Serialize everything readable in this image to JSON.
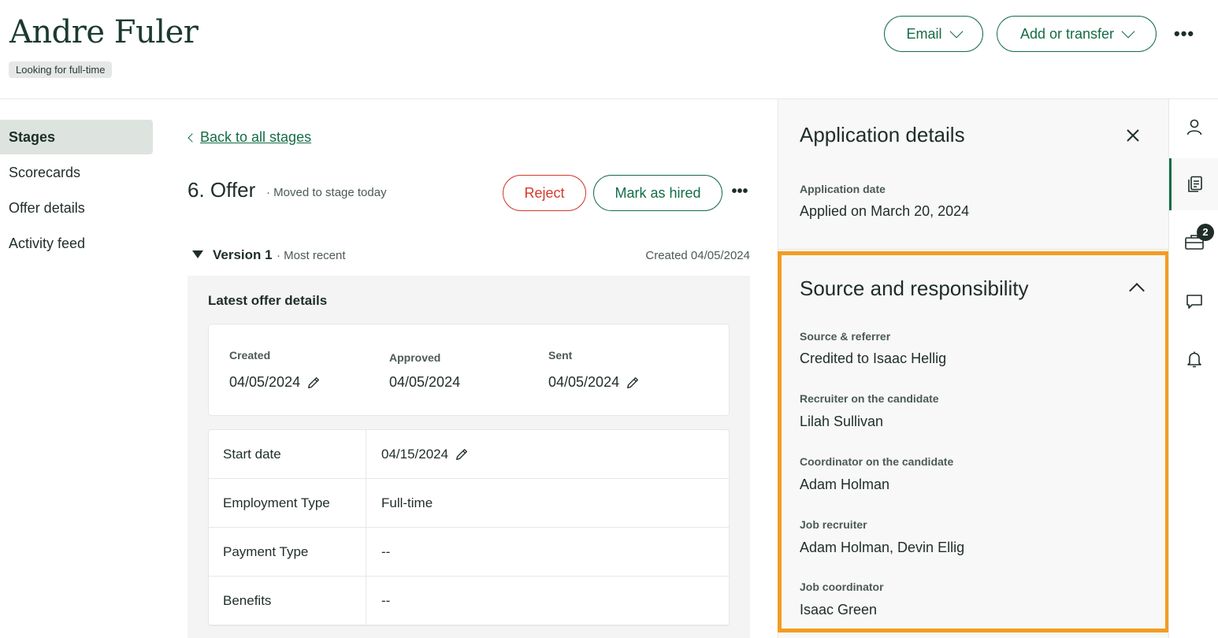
{
  "header": {
    "candidate_name": "Andre Fuler",
    "status_tag": "Looking for full-time",
    "email_label": "Email",
    "add_transfer_label": "Add or transfer",
    "more_label": "•••"
  },
  "leftnav": {
    "items": [
      {
        "label": "Stages",
        "active": true
      },
      {
        "label": "Scorecards",
        "active": false
      },
      {
        "label": "Offer details",
        "active": false
      },
      {
        "label": "Activity feed",
        "active": false
      }
    ]
  },
  "main": {
    "back_link": "Back to all stages",
    "stage_title": "6. Offer",
    "stage_sub": "· Moved to stage today",
    "reject_label": "Reject",
    "hired_label": "Mark as hired",
    "more_label": "•••",
    "version": {
      "label": "Version 1",
      "sub": "· Most recent",
      "created": "Created 04/05/2024"
    },
    "offer": {
      "heading": "Latest offer details",
      "dates": [
        {
          "label": "Created",
          "value": "04/05/2024",
          "editable": true
        },
        {
          "label": "Approved",
          "value": "04/05/2024",
          "editable": false
        },
        {
          "label": "Sent",
          "value": "04/05/2024",
          "editable": true
        }
      ],
      "rows": [
        {
          "label": "Start date",
          "value": "04/15/2024",
          "editable": true
        },
        {
          "label": "Employment Type",
          "value": "Full-time",
          "editable": false
        },
        {
          "label": "Payment Type",
          "value": "--",
          "editable": false
        },
        {
          "label": "Benefits",
          "value": "--",
          "editable": false
        }
      ]
    }
  },
  "rpanel": {
    "title": "Application details",
    "application_date_label": "Application date",
    "application_date_value": "Applied on March 20, 2024",
    "source": {
      "title": "Source and responsibility",
      "fields": [
        {
          "label": "Source & referrer",
          "value": "Credited to Isaac Hellig"
        },
        {
          "label": "Recruiter on the candidate",
          "value": "Lilah Sullivan"
        },
        {
          "label": "Coordinator on the candidate",
          "value": "Adam Holman"
        },
        {
          "label": "Job recruiter",
          "value": "Adam Holman, Devin Ellig"
        },
        {
          "label": "Job coordinator",
          "value": "Isaac Green"
        }
      ]
    }
  },
  "rail": {
    "icons": [
      "person-icon",
      "documents-icon",
      "briefcase-icon",
      "chat-icon",
      "bell-icon"
    ],
    "briefcase_badge": "2"
  },
  "colors": {
    "brand_green": "#146c46",
    "reject_red": "#d23a2a",
    "highlight_orange": "#f39c22"
  }
}
